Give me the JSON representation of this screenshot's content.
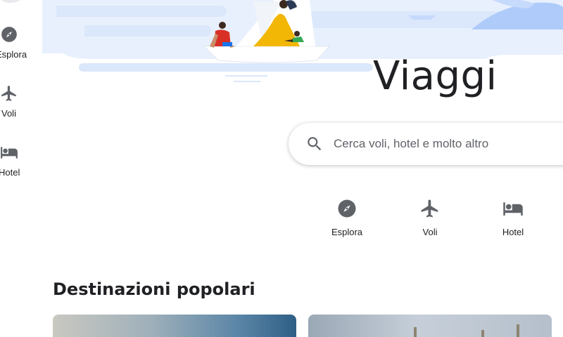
{
  "nav_rail": {
    "items": [
      {
        "label": "Esplora",
        "icon": "compass-icon"
      },
      {
        "label": "Voli",
        "icon": "airplane-icon"
      },
      {
        "label": "Hotel",
        "icon": "bed-icon"
      }
    ]
  },
  "hero": {
    "title": "Viaggi"
  },
  "search": {
    "placeholder": "Cerca voli, hotel e molto altro",
    "icon": "search-icon"
  },
  "categories": [
    {
      "label": "Esplora",
      "icon": "compass-icon"
    },
    {
      "label": "Voli",
      "icon": "airplane-icon"
    },
    {
      "label": "Hotel",
      "icon": "bed-icon"
    }
  ],
  "sections": {
    "popular": {
      "title": "Destinazioni popolari"
    }
  },
  "colors": {
    "icon_gray": "#5f6368",
    "text": "#202124",
    "hero_sky": "#dbe7fb",
    "hero_accent": "#aecbfa"
  }
}
